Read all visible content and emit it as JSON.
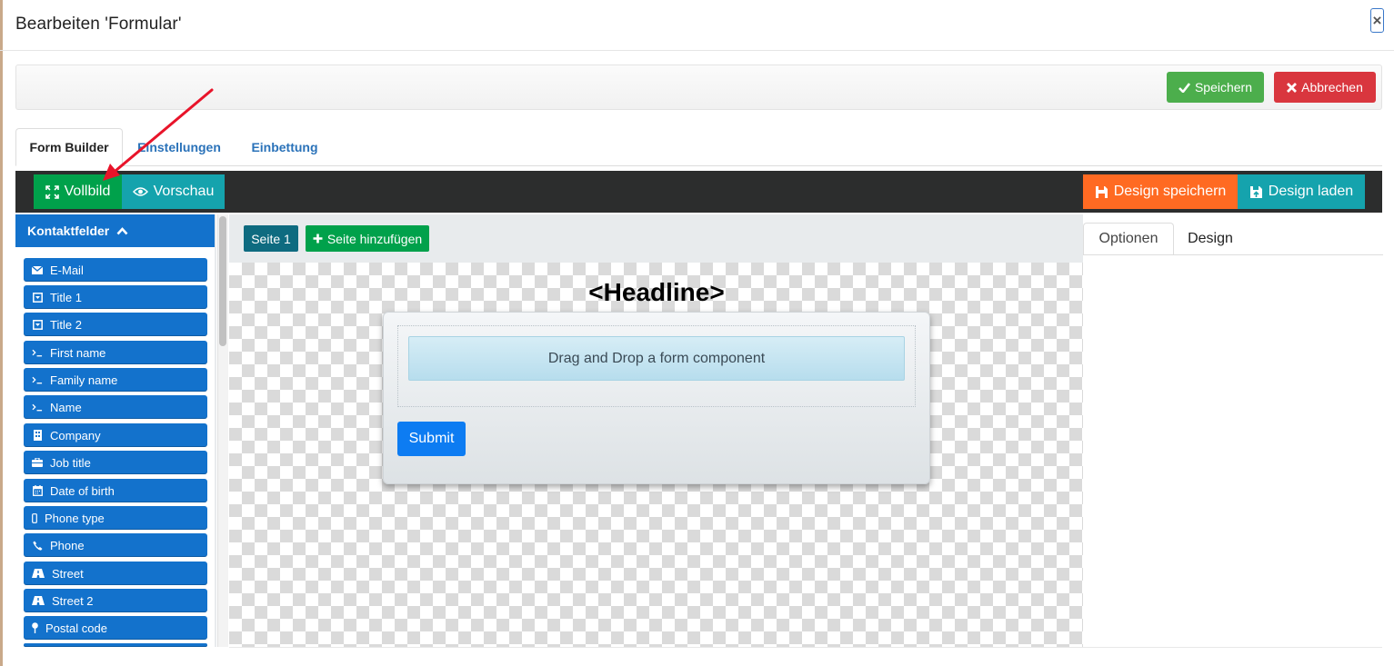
{
  "dialog": {
    "title": "Bearbeiten 'Formular'",
    "close_label": "×"
  },
  "actions": {
    "save_label": "Speichern",
    "cancel_label": "Abbrechen"
  },
  "tabs": [
    {
      "label": "Form Builder",
      "active": true
    },
    {
      "label": "Einstellungen",
      "active": false
    },
    {
      "label": "Einbettung",
      "active": false
    }
  ],
  "toolbar": {
    "fullscreen_label": "Vollbild",
    "preview_label": "Vorschau",
    "design_save_label": "Design speichern",
    "design_load_label": "Design laden"
  },
  "sidebar": {
    "header": "Kontaktfelder",
    "items": [
      {
        "label": "E-Mail",
        "icon": "envelope-icon"
      },
      {
        "label": "Title 1",
        "icon": "dropdown-icon"
      },
      {
        "label": "Title 2",
        "icon": "dropdown-icon"
      },
      {
        "label": "First name",
        "icon": "terminal-icon"
      },
      {
        "label": "Family name",
        "icon": "terminal-icon"
      },
      {
        "label": "Name",
        "icon": "terminal-icon"
      },
      {
        "label": "Company",
        "icon": "building-icon"
      },
      {
        "label": "Job title",
        "icon": "briefcase-icon"
      },
      {
        "label": "Date of birth",
        "icon": "calendar-icon"
      },
      {
        "label": "Phone type",
        "icon": "mobile-icon"
      },
      {
        "label": "Phone",
        "icon": "phone-icon"
      },
      {
        "label": "Street",
        "icon": "road-icon"
      },
      {
        "label": "Street 2",
        "icon": "road-icon"
      },
      {
        "label": "Postal code",
        "icon": "map-pin-icon"
      }
    ]
  },
  "pages": {
    "page1_label": "Seite 1",
    "add_page_label": "Seite hinzufügen"
  },
  "form": {
    "headline": "<Headline>",
    "drop_hint": "Drag and Drop a form component",
    "submit_label": "Submit"
  },
  "right_panel": {
    "tabs": [
      {
        "label": "Optionen",
        "active": true
      },
      {
        "label": "Design",
        "active": false
      }
    ]
  },
  "colors": {
    "primary_blue": "#1372cc",
    "success_green": "#00a14b",
    "teal": "#15a3ad",
    "orange": "#ff6a22",
    "danger_red": "#d9363e",
    "annotation_arrow": "#e8142a"
  }
}
